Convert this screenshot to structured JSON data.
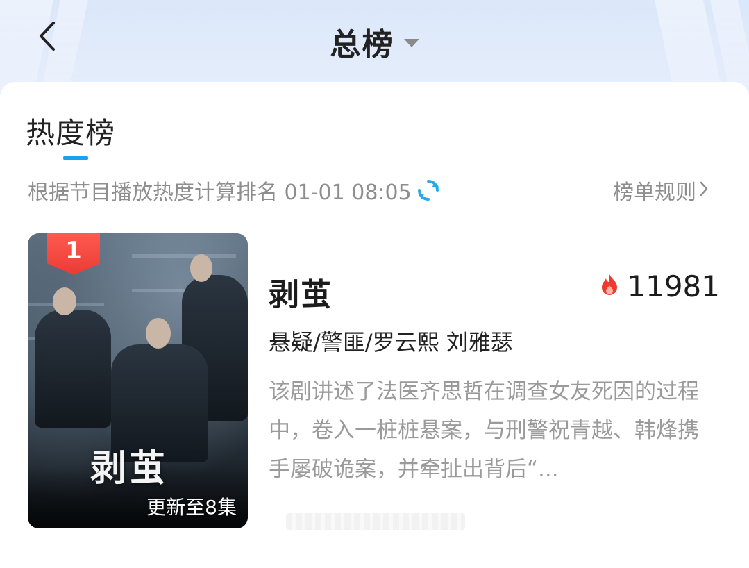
{
  "nav": {
    "title": "总榜"
  },
  "tab": {
    "title": "热度榜"
  },
  "subtitle": {
    "text": "根据节目播放热度计算排名 01-01 08:05",
    "rules_label": "榜单规则"
  },
  "item": {
    "rank": "1",
    "title": "剥茧",
    "poster_title": "剥茧",
    "update_text": "更新至8集",
    "heat_value": "11981",
    "meta": "悬疑/警匪/罗云熙 刘雅瑟",
    "description": "该剧讲述了法医齐思哲在调查女友死因的过程中，卷入一桩桩悬案，与刑警祝青越、韩烽携手屡破诡案，并牵扯出背后“..."
  },
  "colors": {
    "accent": "#1aa0ee",
    "rank_badge": "#ea3b34",
    "heat_icon": "#f03a2e"
  },
  "icons": {
    "back": "chevron-left-icon",
    "dropdown": "caret-down-icon",
    "refresh": "refresh-icon",
    "rules_arrow": "chevron-right-icon",
    "heat": "flame-icon"
  }
}
